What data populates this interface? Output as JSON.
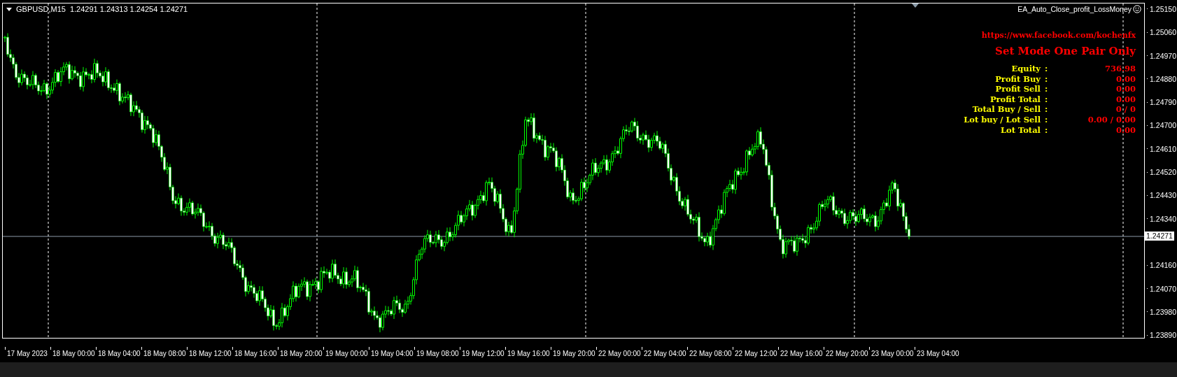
{
  "chart": {
    "symbol_title": "GBPUSD,M15",
    "ohlc": "1.24291 1.24313 1.24254 1.24271",
    "expert_name": "EA_Auto_Close_profit_LossMoney",
    "current_price": "1.24271",
    "panel": {
      "link": "https://www.facebook.com/kochenfx",
      "mode": "Set Mode One Pair Only",
      "rows": [
        {
          "label": "Equity",
          "separator": ":",
          "value": "736.98"
        },
        {
          "label": "Profit Buy",
          "separator": ":",
          "value": "0.00"
        },
        {
          "label": "Profit Sell",
          "separator": ":",
          "value": "0.00"
        },
        {
          "label": "Profit Total",
          "separator": ":",
          "value": "0.00"
        },
        {
          "label": "Total Buy / Sell",
          "separator": ":",
          "value": "0 / 0"
        },
        {
          "label": "Lot buy / Lot Sell",
          "separator": ":",
          "value": "0.00 / 0.00"
        },
        {
          "label": "Lot Total",
          "separator": ":",
          "value": "0.00"
        }
      ]
    },
    "price_axis_upper": [
      "1.25150",
      "1.25060",
      "1.24970",
      "1.24880",
      "1.24790",
      "1.24700",
      "1.24610",
      "1.24520",
      "1.24430",
      "1.24340"
    ],
    "price_axis_lower": [
      "1.24160",
      "1.24070",
      "1.23980",
      "1.23890"
    ],
    "time_axis": [
      "17 May 2023",
      "18 May 00:00",
      "18 May 04:00",
      "18 May 08:00",
      "18 May 12:00",
      "18 May 16:00",
      "18 May 20:00",
      "19 May 00:00",
      "19 May 04:00",
      "19 May 08:00",
      "19 May 12:00",
      "19 May 16:00",
      "19 May 20:00",
      "22 May 00:00",
      "22 May 04:00",
      "22 May 08:00",
      "22 May 12:00",
      "22 May 16:00",
      "22 May 20:00",
      "23 May 00:00",
      "23 May 04:00"
    ]
  }
}
